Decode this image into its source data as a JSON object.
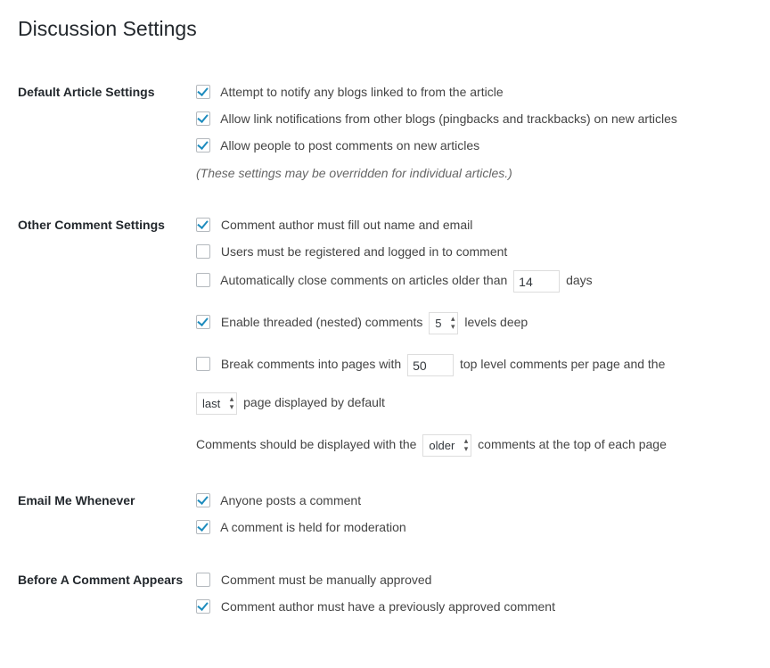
{
  "page_title": "Discussion Settings",
  "sections": {
    "default_article": {
      "heading": "Default Article Settings",
      "opt_notify": "Attempt to notify any blogs linked to from the article",
      "opt_allow_pings": "Allow link notifications from other blogs (pingbacks and trackbacks) on new articles",
      "opt_allow_comments": "Allow people to post comments on new articles",
      "note": "(These settings may be overridden for individual articles.)"
    },
    "other_comments": {
      "heading": "Other Comment Settings",
      "opt_name_email": "Comment author must fill out name and email",
      "opt_registered": "Users must be registered and logged in to comment",
      "auto_close_pre": "Automatically close comments on articles older than",
      "auto_close_days_value": "14",
      "auto_close_post": "days",
      "threaded_pre": "Enable threaded (nested) comments",
      "threaded_levels_value": "5",
      "threaded_post": "levels deep",
      "paged_pre": "Break comments into pages with",
      "paged_per_page_value": "50",
      "paged_mid": "top level comments per page and the",
      "paged_default_page_value": "last",
      "paged_post": "page displayed by default",
      "order_pre": "Comments should be displayed with the",
      "order_value": "older",
      "order_post": "comments at the top of each page"
    },
    "email_me": {
      "heading": "Email Me Whenever",
      "opt_anyone": "Anyone posts a comment",
      "opt_held": "A comment is held for moderation"
    },
    "before_appears": {
      "heading": "Before A Comment Appears",
      "opt_manual": "Comment must be manually approved",
      "opt_prev_approved": "Comment author must have a previously approved comment"
    }
  }
}
